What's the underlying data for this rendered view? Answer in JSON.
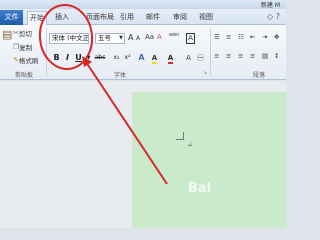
{
  "window": {
    "title": "新建 M"
  },
  "tabs": {
    "file": "文件",
    "start": "开始",
    "insert": "插入",
    "page_layout": "页面布局",
    "references": "引用",
    "mailings": "邮件",
    "review": "审阅",
    "view": "视图"
  },
  "clipboard": {
    "cut": "剪切",
    "copy": "复制",
    "format_painter": "格式刷",
    "group_label": "剪贴板"
  },
  "font_group": {
    "font_name": "宋体 (中文正",
    "font_size": "五号",
    "group_label": "字体",
    "bold": "B",
    "italic": "I",
    "underline": "U",
    "strikethrough": "abc",
    "grow_font": "A",
    "shrink_font": "A",
    "change_case": "Aa",
    "clear_format": "A",
    "phonetic": "wén",
    "char_border": "A",
    "font_color": "A",
    "highlight": "A"
  },
  "paragraph_group": {
    "group_label": "段落"
  },
  "watermark": "Bai",
  "accent_colors": {
    "file_tab": "#2a69b8",
    "annotation_red": "#d62828",
    "page_green": "#c9ebcc"
  }
}
